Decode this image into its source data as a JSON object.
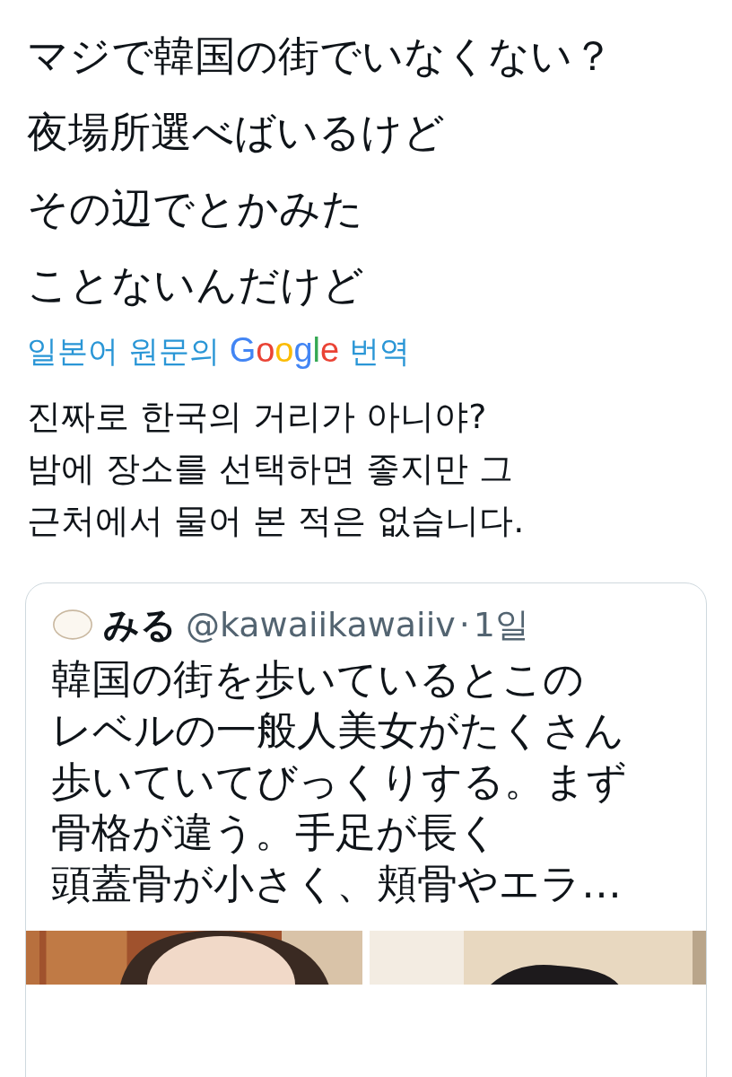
{
  "tweet": {
    "text_lines": [
      "マジで韓国の街でいなくない？",
      "夜場所選べばいるけど",
      "その辺でとかみた",
      "ことないんだけど"
    ],
    "translation_link": {
      "prefix": "일본어 원문의",
      "brand": "Google",
      "suffix": "번역"
    },
    "translation_lines": [
      "진짜로 한국의 거리가 아니야?",
      "밤에 장소를 선택하면 좋지만 그",
      "근처에서 물어 본 적은 없습니다."
    ]
  },
  "quoted_tweet": {
    "name": "みる",
    "handle": "@kawaiikawaiiv",
    "separator": "·",
    "time": "1일",
    "text_lines": [
      "韓国の街を歩いているとこの",
      "レベルの一般人美女がたくさん",
      "歩いていてびっくりする。まず",
      "骨格が違う。手足が長く",
      "頭蓋骨が小さく、頬骨やエラ…"
    ]
  }
}
